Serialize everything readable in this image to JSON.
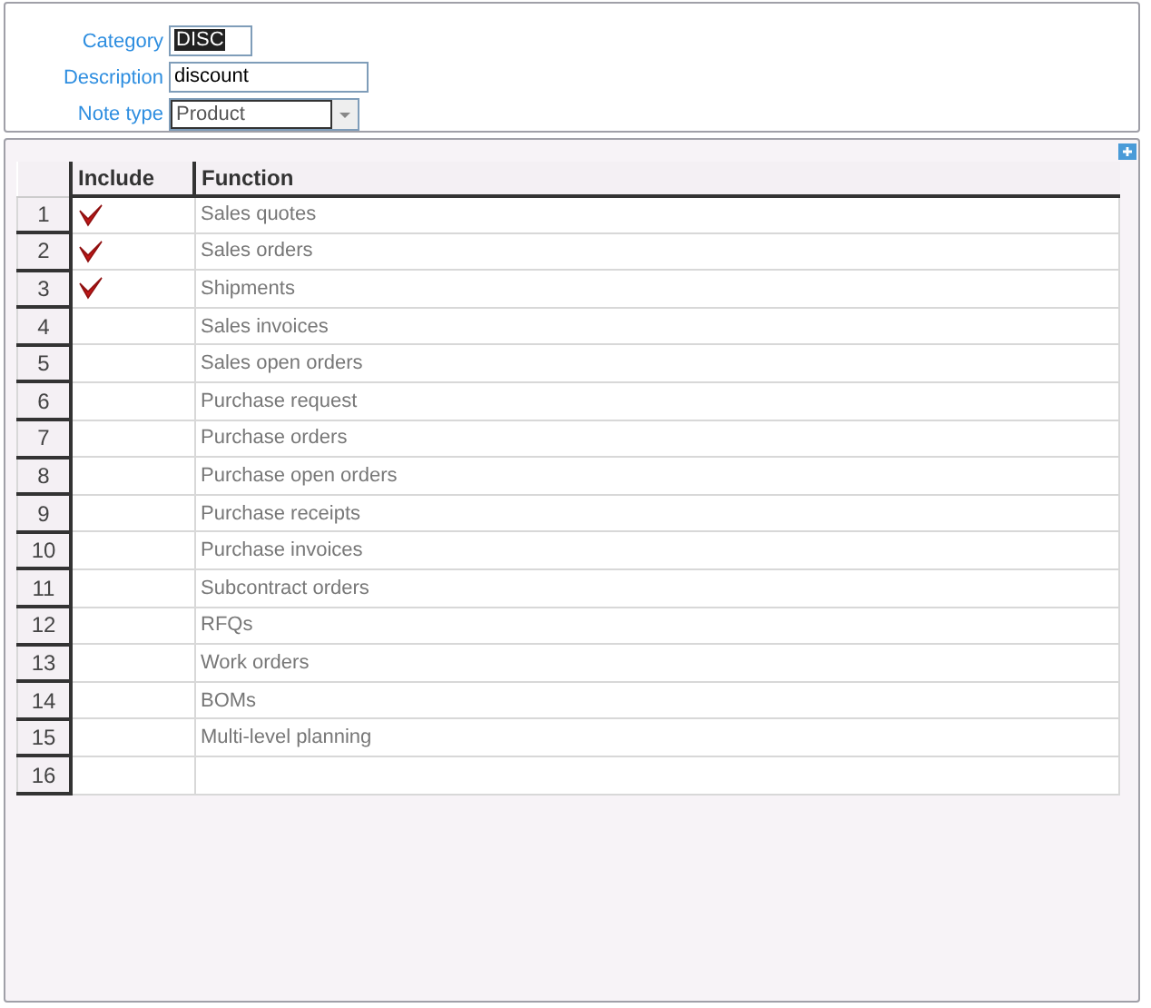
{
  "form": {
    "fields": [
      {
        "label": "Category",
        "value": "DISC",
        "kind": "selected-text"
      },
      {
        "label": "Description",
        "value": "discount",
        "kind": "text"
      },
      {
        "label": "Note type",
        "value": "Product",
        "kind": "dropdown"
      }
    ]
  },
  "table": {
    "columns": [
      "Include",
      "Function"
    ],
    "rows": [
      {
        "number": "1",
        "checked": true,
        "function": "Sales quotes"
      },
      {
        "number": "2",
        "checked": true,
        "function": "Sales orders"
      },
      {
        "number": "3",
        "checked": true,
        "function": "Shipments"
      },
      {
        "number": "4",
        "checked": false,
        "function": "Sales invoices"
      },
      {
        "number": "5",
        "checked": false,
        "function": "Sales open orders"
      },
      {
        "number": "6",
        "checked": false,
        "function": "Purchase request"
      },
      {
        "number": "7",
        "checked": false,
        "function": "Purchase orders"
      },
      {
        "number": "8",
        "checked": false,
        "function": "Purchase open orders"
      },
      {
        "number": "9",
        "checked": false,
        "function": "Purchase receipts"
      },
      {
        "number": "10",
        "checked": false,
        "function": "Purchase invoices"
      },
      {
        "number": "11",
        "checked": false,
        "function": "Subcontract orders"
      },
      {
        "number": "12",
        "checked": false,
        "function": "RFQs"
      },
      {
        "number": "13",
        "checked": false,
        "function": "Work orders"
      },
      {
        "number": "14",
        "checked": false,
        "function": "BOMs"
      },
      {
        "number": "15",
        "checked": false,
        "function": "Multi-level planning"
      },
      {
        "number": "16",
        "checked": false
      }
    ]
  }
}
